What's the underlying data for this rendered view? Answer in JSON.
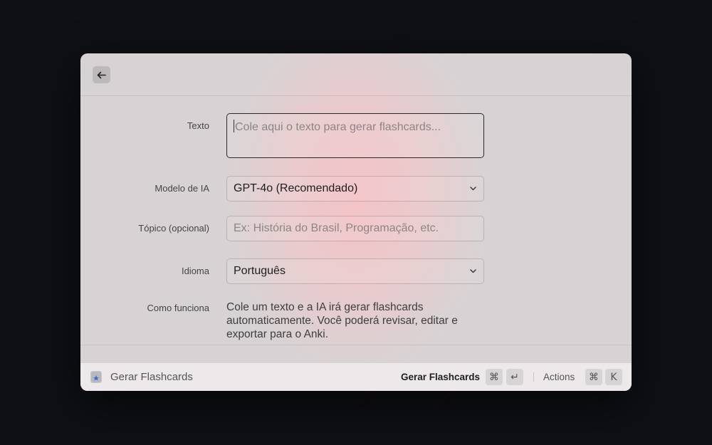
{
  "form": {
    "text_label": "Texto",
    "text_placeholder": "Cole aqui o texto para gerar flashcards...",
    "model_label": "Modelo de IA",
    "model_value": "GPT-4o (Recomendado)",
    "topic_label": "Tópico (opcional)",
    "topic_placeholder": "Ex: História do Brasil, Programação, etc.",
    "language_label": "Idioma",
    "language_value": "Português",
    "how_label": "Como funciona",
    "how_text": "Cole um texto e a IA irá gerar flashcards automaticamente. Você poderá revisar, editar e exportar para o Anki."
  },
  "footer": {
    "title": "Gerar Flashcards",
    "primary_action": "Gerar Flashcards",
    "primary_keys": [
      "⌘",
      "↵"
    ],
    "secondary_action": "Actions",
    "secondary_keys": [
      "⌘",
      "K"
    ]
  },
  "icons": {
    "back": "arrow-left-icon",
    "chevron": "chevron-down-icon",
    "app": "app-icon"
  }
}
